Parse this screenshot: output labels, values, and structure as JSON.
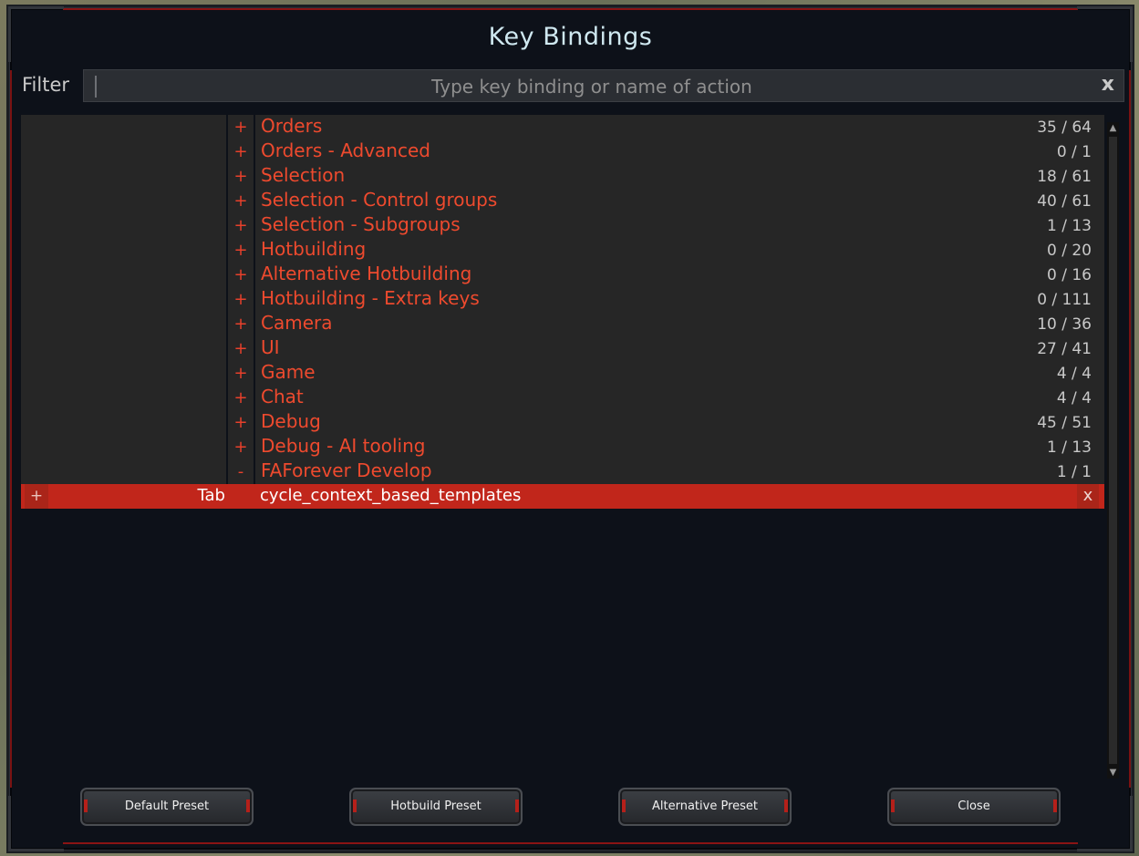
{
  "title": "Key Bindings",
  "filter": {
    "label": "Filter",
    "placeholder": "Type key binding or name of action",
    "clear": "x"
  },
  "categories": [
    {
      "expander": "+",
      "name": "Orders",
      "count": "35 / 64"
    },
    {
      "expander": "+",
      "name": "Orders - Advanced",
      "count": "0 / 1"
    },
    {
      "expander": "+",
      "name": "Selection",
      "count": "18 / 61"
    },
    {
      "expander": "+",
      "name": "Selection - Control groups",
      "count": "40 / 61"
    },
    {
      "expander": "+",
      "name": "Selection - Subgroups",
      "count": "1 / 13"
    },
    {
      "expander": "+",
      "name": "Hotbuilding",
      "count": "0 / 20"
    },
    {
      "expander": "+",
      "name": "Alternative Hotbuilding",
      "count": "0 / 16"
    },
    {
      "expander": "+",
      "name": "Hotbuilding - Extra keys",
      "count": "0 / 111"
    },
    {
      "expander": "+",
      "name": "Camera",
      "count": "10 / 36"
    },
    {
      "expander": "+",
      "name": "UI",
      "count": "27 / 41"
    },
    {
      "expander": "+",
      "name": "Game",
      "count": "4 / 4"
    },
    {
      "expander": "+",
      "name": "Chat",
      "count": "4 / 4"
    },
    {
      "expander": "+",
      "name": "Debug",
      "count": "45 / 51"
    },
    {
      "expander": "+",
      "name": "Debug - AI tooling",
      "count": "1 / 13"
    },
    {
      "expander": "-",
      "name": "FAForever Develop",
      "count": "1 / 1"
    }
  ],
  "selected_action": {
    "add": "+",
    "key": "Tab",
    "action": "cycle_context_based_templates",
    "remove": "x"
  },
  "scrollbar": {
    "up": "▲",
    "down": "▼"
  },
  "buttons": {
    "default_preset": "Default Preset",
    "hotbuild_preset": "Hotbuild Preset",
    "alternative_preset": "Alternative Preset",
    "close": "Close"
  },
  "colors": {
    "category_text": "#ee4a2e",
    "selected_row": "#c1261b",
    "panel_bg": "#0d1119"
  }
}
